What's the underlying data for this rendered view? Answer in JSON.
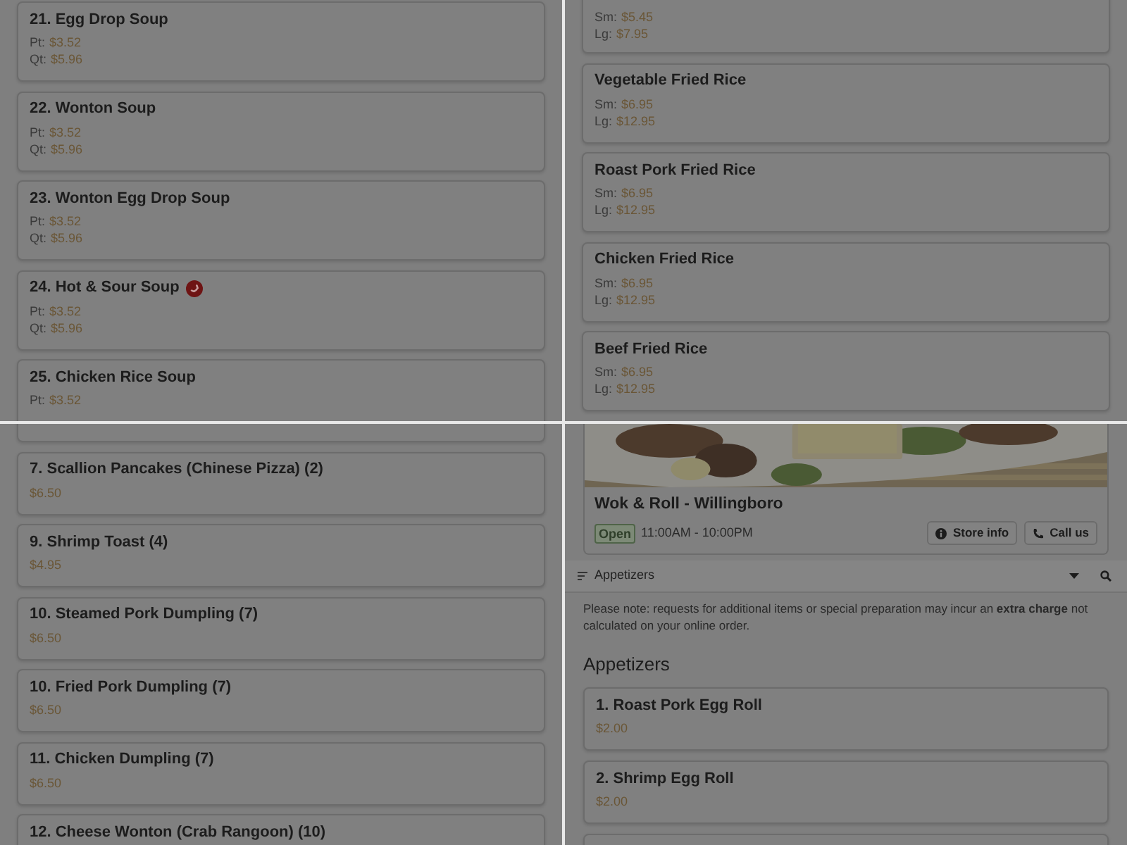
{
  "panels": [
    {
      "kind": "menu",
      "items": [
        {
          "title": "21. Egg Drop Soup",
          "prices": [
            {
              "label": "Pt:",
              "value": "$3.52"
            },
            {
              "label": "Qt:",
              "value": "$5.96"
            }
          ]
        },
        {
          "title": "22. Wonton Soup",
          "prices": [
            {
              "label": "Pt:",
              "value": "$3.52"
            },
            {
              "label": "Qt:",
              "value": "$5.96"
            }
          ]
        },
        {
          "title": "23. Wonton Egg Drop Soup",
          "prices": [
            {
              "label": "Pt:",
              "value": "$3.52"
            },
            {
              "label": "Qt:",
              "value": "$5.96"
            }
          ]
        },
        {
          "title": "24. Hot & Sour Soup",
          "spicy": true,
          "prices": [
            {
              "label": "Pt:",
              "value": "$3.52"
            },
            {
              "label": "Qt:",
              "value": "$5.96"
            }
          ]
        },
        {
          "title": "25. Chicken Rice Soup",
          "prices": [
            {
              "label": "Pt:",
              "value": "$3.52"
            }
          ]
        }
      ]
    },
    {
      "kind": "menu",
      "items": [
        {
          "prices": [
            {
              "label": "Sm:",
              "value": "$5.45"
            },
            {
              "label": "Lg:",
              "value": "$7.95"
            }
          ]
        },
        {
          "title": "Vegetable Fried Rice",
          "prices": [
            {
              "label": "Sm:",
              "value": "$6.95"
            },
            {
              "label": "Lg:",
              "value": "$12.95"
            }
          ]
        },
        {
          "title": "Roast Pork Fried Rice",
          "prices": [
            {
              "label": "Sm:",
              "value": "$6.95"
            },
            {
              "label": "Lg:",
              "value": "$12.95"
            }
          ]
        },
        {
          "title": "Chicken Fried Rice",
          "prices": [
            {
              "label": "Sm:",
              "value": "$6.95"
            },
            {
              "label": "Lg:",
              "value": "$12.95"
            }
          ]
        },
        {
          "title": "Beef Fried Rice",
          "prices": [
            {
              "label": "Sm:",
              "value": "$6.95"
            },
            {
              "label": "Lg:",
              "value": "$12.95"
            }
          ]
        }
      ]
    },
    {
      "kind": "menu",
      "items": [
        {
          "kind": "edge"
        },
        {
          "title": "7. Scallion Pancakes (Chinese Pizza) (2)",
          "prices": [
            {
              "value": "$6.50"
            }
          ]
        },
        {
          "title": "9. Shrimp Toast (4)",
          "prices": [
            {
              "value": "$4.95"
            }
          ]
        },
        {
          "title": "10. Steamed Pork Dumpling (7)",
          "prices": [
            {
              "value": "$6.50"
            }
          ]
        },
        {
          "title": "10. Fried Pork Dumpling (7)",
          "prices": [
            {
              "value": "$6.50"
            }
          ]
        },
        {
          "title": "11. Chicken Dumpling (7)",
          "prices": [
            {
              "value": "$6.50"
            }
          ]
        },
        {
          "title": "12. Cheese Wonton (Crab Rangoon) (10)"
        }
      ]
    },
    {
      "kind": "store",
      "store": {
        "name": "Wok & Roll - Willingboro",
        "status": "Open",
        "hours": "11:00AM - 10:00PM",
        "buttons": [
          {
            "kind": "info",
            "label": "Store info"
          },
          {
            "kind": "phone",
            "label": "Call us"
          }
        ]
      },
      "category_bar": {
        "label": "Appetizers"
      },
      "note": "Please note: requests for additional items or special preparation may incur an **extra charge** not calculated on your online order.",
      "heading": "Appetizers",
      "items": [
        {
          "title": "1. Roast Pork Egg Roll",
          "prices": [
            {
              "value": "$2.00"
            }
          ]
        },
        {
          "title": "2. Shrimp Egg Roll",
          "prices": [
            {
              "value": "$2.00"
            }
          ]
        },
        {
          "kind": "edge"
        }
      ]
    }
  ]
}
